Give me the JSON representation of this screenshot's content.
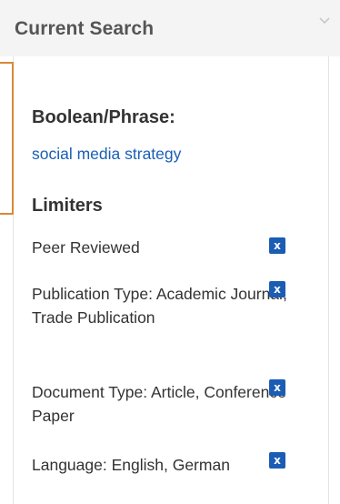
{
  "header": {
    "title": "Current Search",
    "collapse_icon": "chevron-down-icon"
  },
  "search": {
    "boolean_heading": "Boolean/Phrase:",
    "query": "social media strategy"
  },
  "limiters": {
    "heading": "Limiters",
    "remove_label": "x",
    "items": [
      {
        "label": "Peer Reviewed"
      },
      {
        "label": "Publication Type: Academic Journal, Trade Publication"
      },
      {
        "label": "Document Type: Article, Conference Paper"
      },
      {
        "label": "Language: English, German"
      }
    ]
  },
  "colors": {
    "link": "#1a5fb4",
    "remove_button": "#1b5cb4",
    "accent": "#d98838",
    "header_bg": "#f4f4f4"
  }
}
